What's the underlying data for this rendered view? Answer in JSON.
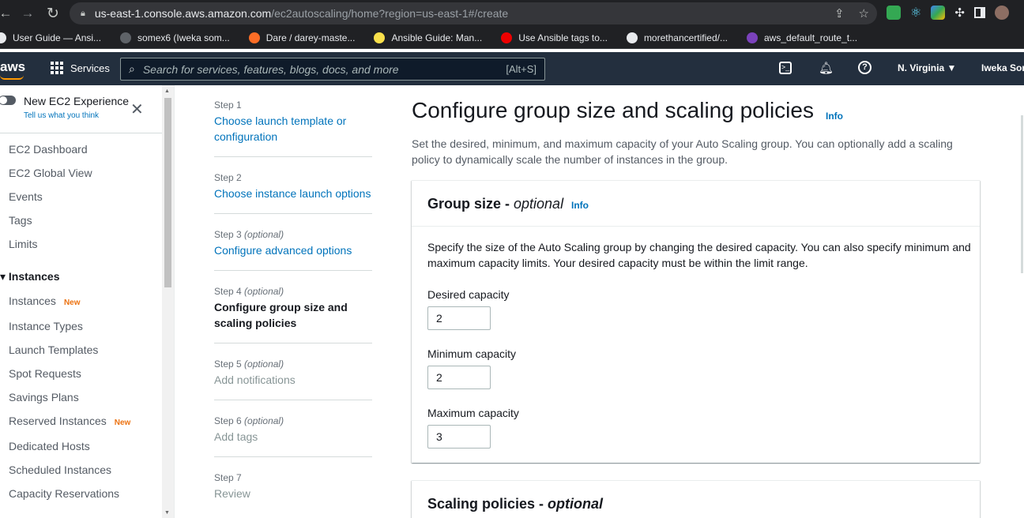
{
  "browser": {
    "url_host": "us-east-1.console.aws.amazon.com",
    "url_path": "/ec2autoscaling/home?region=us-east-1#/create",
    "bookmarks": [
      {
        "label": "User Guide — Ansi...",
        "color": "#e8eaed"
      },
      {
        "label": "somex6 (Iweka som...",
        "color": "#5f6368"
      },
      {
        "label": "Dare / darey-maste...",
        "color": "#fc6d26"
      },
      {
        "label": "Ansible Guide: Man...",
        "color": "#f9e04b"
      },
      {
        "label": "Use Ansible tags to...",
        "color": "#ee0000"
      },
      {
        "label": "morethancertified/...",
        "color": "#e8eaed"
      },
      {
        "label": "aws_default_route_t...",
        "color": "#7b42bc"
      }
    ]
  },
  "aws_header": {
    "logo": "aws",
    "services": "Services",
    "search_placeholder": "Search for services, features, blogs, docs, and more",
    "search_shortcut": "[Alt+S]",
    "region": "N. Virginia ▼",
    "user": "Iweka Som"
  },
  "sidebar": {
    "toggle_label": "New EC2 Experience",
    "tell_us": "Tell us what you think",
    "items": [
      {
        "label": "EC2 Dashboard"
      },
      {
        "label": "EC2 Global View"
      },
      {
        "label": "Events"
      },
      {
        "label": "Tags"
      },
      {
        "label": "Limits"
      }
    ],
    "section": "▾ Instances",
    "instance_items": [
      {
        "label": "Instances",
        "badge": "New"
      },
      {
        "label": "Instance Types",
        "badge": ""
      },
      {
        "label": "Launch Templates",
        "badge": ""
      },
      {
        "label": "Spot Requests",
        "badge": ""
      },
      {
        "label": "Savings Plans",
        "badge": ""
      },
      {
        "label": "Reserved Instances",
        "badge": "New"
      },
      {
        "label": "Dedicated Hosts",
        "badge": ""
      },
      {
        "label": "Scheduled Instances",
        "badge": ""
      },
      {
        "label": "Capacity Reservations",
        "badge": ""
      }
    ]
  },
  "steps": [
    {
      "step": "Step 1",
      "optional": "",
      "title": "Choose launch template or configuration",
      "state": "link"
    },
    {
      "step": "Step 2",
      "optional": "",
      "title": "Choose instance launch options",
      "state": "link"
    },
    {
      "step": "Step 3",
      "optional": "(optional)",
      "title": "Configure advanced options",
      "state": "link"
    },
    {
      "step": "Step 4",
      "optional": "(optional)",
      "title": "Configure group size and scaling policies",
      "state": "current"
    },
    {
      "step": "Step 5",
      "optional": "(optional)",
      "title": "Add notifications",
      "state": "disabled"
    },
    {
      "step": "Step 6",
      "optional": "(optional)",
      "title": "Add tags",
      "state": "disabled"
    },
    {
      "step": "Step 7",
      "optional": "",
      "title": "Review",
      "state": "disabled"
    }
  ],
  "main": {
    "title": "Configure group size and scaling policies",
    "info": "Info",
    "description": "Set the desired, minimum, and maximum capacity of your Auto Scaling group. You can optionally add a scaling policy to dynamically scale the number of instances in the group.",
    "group_size": {
      "title": "Group size - ",
      "title_optional": "optional",
      "info": "Info",
      "description": "Specify the size of the Auto Scaling group by changing the desired capacity. You can also specify minimum and maximum capacity limits. Your desired capacity must be within the limit range.",
      "desired_label": "Desired capacity",
      "desired_value": "2",
      "min_label": "Minimum capacity",
      "min_value": "2",
      "max_label": "Maximum capacity",
      "max_value": "3"
    },
    "scaling": {
      "title": "Scaling policies - ",
      "title_optional": "optional"
    }
  },
  "colors": {
    "aws_header": "#232f3e",
    "link": "#0073bb",
    "badge_new": "#ec7211"
  }
}
